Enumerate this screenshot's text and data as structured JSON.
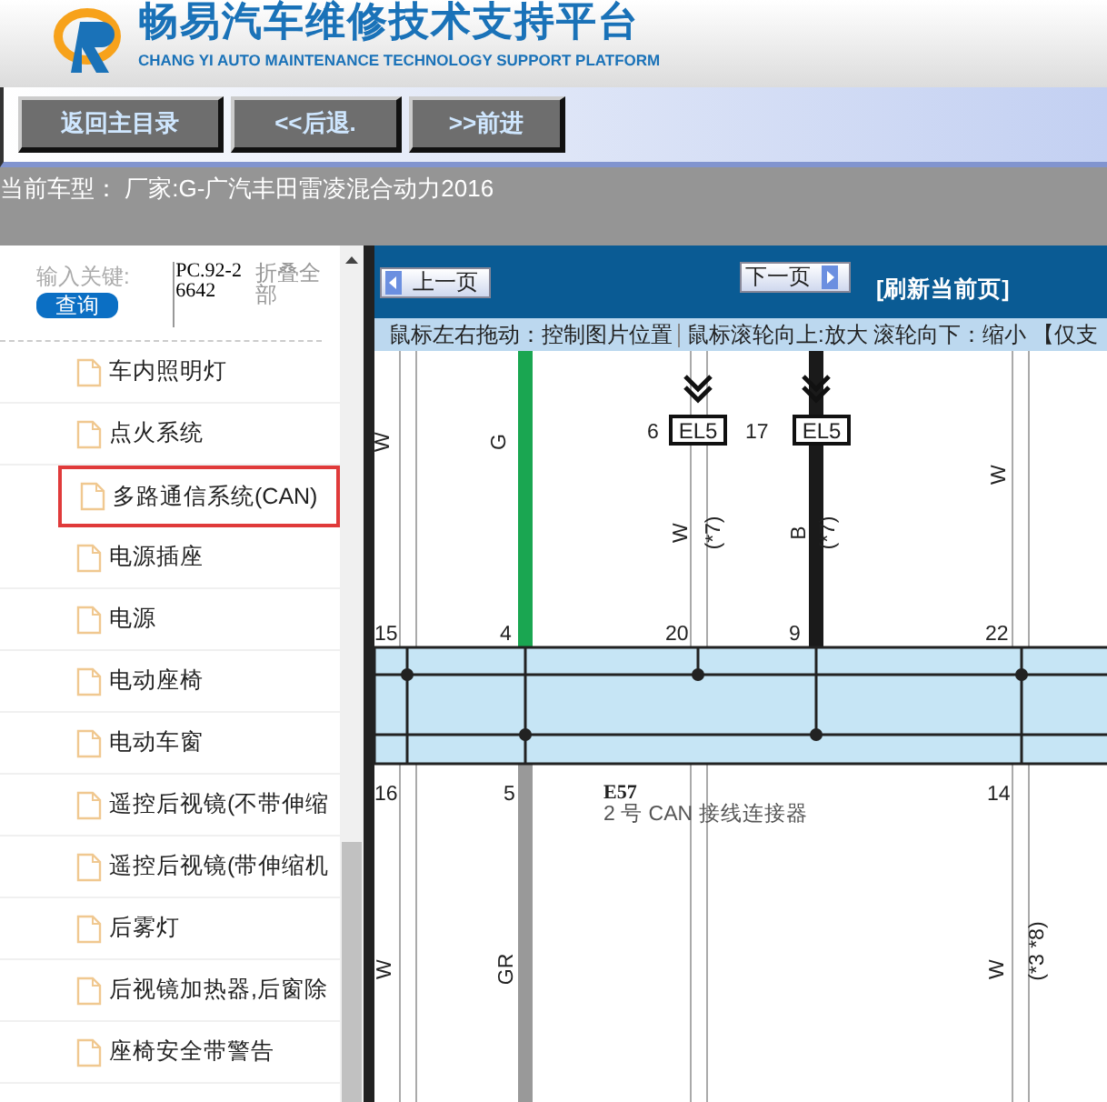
{
  "header": {
    "title": "畅易汽车维修技术支持平台",
    "subtitle": "CHANG YI AUTO MAINTENANCE TECHNOLOGY SUPPORT PLATFORM"
  },
  "nav_buttons": [
    "返回主目录",
    "<<后退.",
    ">>前进"
  ],
  "car_model": {
    "label": "当前车型：",
    "value": "厂家:G-广汽丰田雷凌混合动力2016"
  },
  "sidebar": {
    "search": {
      "label": "输入关键:",
      "value": "PC.92-26642",
      "button": "查询",
      "collapse": "折叠全部"
    },
    "items": [
      {
        "label": "车内照明灯",
        "selected": false
      },
      {
        "label": "点火系统",
        "selected": false
      },
      {
        "label": "多路通信系统(CAN)",
        "selected": true
      },
      {
        "label": "电源插座",
        "selected": false
      },
      {
        "label": "电源",
        "selected": false
      },
      {
        "label": "电动座椅",
        "selected": false
      },
      {
        "label": "电动车窗",
        "selected": false
      },
      {
        "label": "遥控后视镜(不带伸缩",
        "selected": false
      },
      {
        "label": "遥控后视镜(带伸缩机",
        "selected": false
      },
      {
        "label": "后雾灯",
        "selected": false
      },
      {
        "label": "后视镜加热器,后窗除",
        "selected": false
      },
      {
        "label": "座椅安全带警告",
        "selected": false
      }
    ]
  },
  "viewer": {
    "prev": "上一页",
    "next": "下一页",
    "refresh": "[刷新当前页]",
    "hint_1": "鼠标左右拖动：控制图片位置",
    "hint_2": "鼠标滚轮向上:放大  滚轮向下：缩小 【仅支",
    "diagram_labels": [
      "W",
      "G",
      "6",
      "EL5",
      "17",
      "EL5",
      "W",
      "(*7)",
      "B",
      "(*7)",
      "W",
      "15",
      "4",
      "20",
      "9",
      "22",
      "16",
      "5",
      "E57",
      "2 号 CAN 接线连接器",
      "14",
      "W",
      "GR",
      "W",
      "(*3 *8)"
    ]
  }
}
